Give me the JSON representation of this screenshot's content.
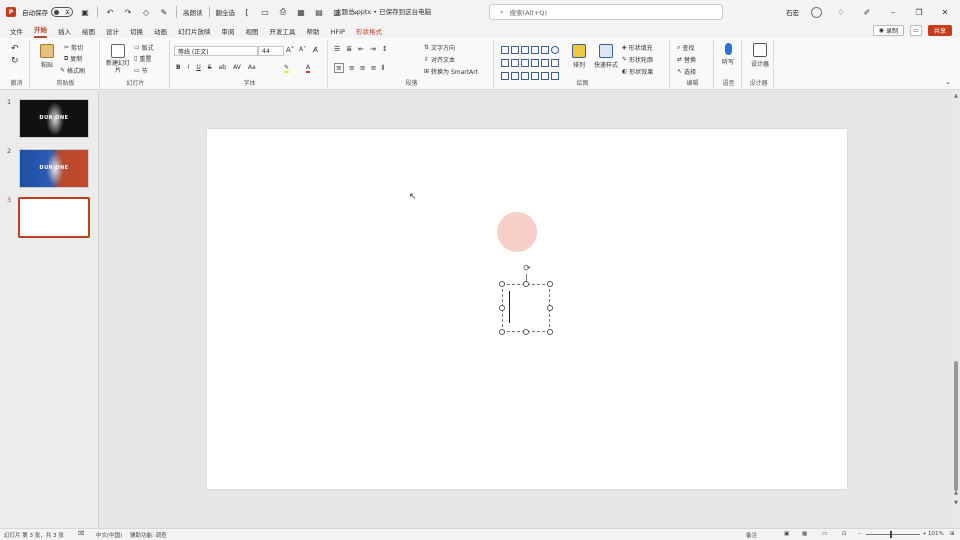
{
  "titlebar": {
    "autosave_label": "自动保存",
    "autosave_state": "关",
    "qat_text_1": "高朗读",
    "qat_text_2": "翻全选",
    "doc_title": "主题总.pptx • 已保存到这台电脑",
    "search_placeholder": "搜索(Alt+Q)",
    "user_name": "石宏"
  },
  "tabs": {
    "items": [
      "文件",
      "开始",
      "插入",
      "绘图",
      "设计",
      "切换",
      "动画",
      "幻灯片放映",
      "审阅",
      "视图",
      "开发工具",
      "帮助",
      "HFIP",
      "形状格式"
    ],
    "active_index": 1,
    "contextual_index": 13,
    "record_label": "录制",
    "share_label": "共享"
  },
  "ribbon": {
    "undo_group": "撤消",
    "clipboard": {
      "paste": "粘贴",
      "cut": "剪切",
      "copy": "复制",
      "format_painter": "格式刷",
      "label": "剪贴板"
    },
    "slides": {
      "new_slide": "新建幻灯片",
      "layout": "版式",
      "reset": "重置",
      "section": "节",
      "label": "幻灯片"
    },
    "font": {
      "font_name": "等线 (正文)",
      "font_size": "44",
      "label": "字体",
      "buttons": [
        "B",
        "I",
        "U",
        "S",
        "ab",
        "AV",
        "Aa"
      ]
    },
    "paragraph": {
      "text_direction": "文字方向",
      "align_text": "对齐文本",
      "smartart": "转换为 SmartArt",
      "label": "段落"
    },
    "drawing": {
      "arrange": "排列",
      "quick_styles": "快速样式",
      "fill": "形状填充",
      "outline": "形状轮廓",
      "effects": "形状效果",
      "label": "绘图"
    },
    "editing": {
      "find": "查找",
      "replace": "替换",
      "select": "选择",
      "label": "编辑"
    },
    "voice": {
      "dictate": "听写",
      "label": "语音"
    },
    "designer": {
      "designer": "设计器",
      "label": "设计器"
    }
  },
  "slides_panel": {
    "items": [
      {
        "number": "1",
        "title": "DUR ONE"
      },
      {
        "number": "2",
        "title": "DUR ONE"
      },
      {
        "number": "3",
        "title": ""
      }
    ],
    "active_index": 2
  },
  "statusbar": {
    "slide_count": "幻灯片 第 3 张，共 3 张",
    "language": "中文(中国)",
    "accessibility": "辅助功能: 调查",
    "notes": "备注",
    "zoom": "101%"
  },
  "colors": {
    "accent": "#c43e1c",
    "thumb2_left": "#1e4fa0",
    "thumb2_right": "#c24a28"
  }
}
